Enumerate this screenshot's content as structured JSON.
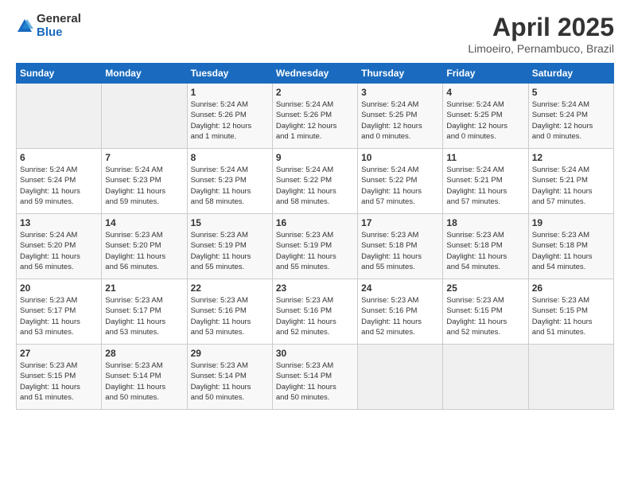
{
  "logo": {
    "general": "General",
    "blue": "Blue"
  },
  "title": {
    "month_year": "April 2025",
    "location": "Limoeiro, Pernambuco, Brazil"
  },
  "header": {
    "days": [
      "Sunday",
      "Monday",
      "Tuesday",
      "Wednesday",
      "Thursday",
      "Friday",
      "Saturday"
    ]
  },
  "weeks": [
    [
      {
        "day": "",
        "info": ""
      },
      {
        "day": "",
        "info": ""
      },
      {
        "day": "1",
        "info": "Sunrise: 5:24 AM\nSunset: 5:26 PM\nDaylight: 12 hours\nand 1 minute."
      },
      {
        "day": "2",
        "info": "Sunrise: 5:24 AM\nSunset: 5:26 PM\nDaylight: 12 hours\nand 1 minute."
      },
      {
        "day": "3",
        "info": "Sunrise: 5:24 AM\nSunset: 5:25 PM\nDaylight: 12 hours\nand 0 minutes."
      },
      {
        "day": "4",
        "info": "Sunrise: 5:24 AM\nSunset: 5:25 PM\nDaylight: 12 hours\nand 0 minutes."
      },
      {
        "day": "5",
        "info": "Sunrise: 5:24 AM\nSunset: 5:24 PM\nDaylight: 12 hours\nand 0 minutes."
      }
    ],
    [
      {
        "day": "6",
        "info": "Sunrise: 5:24 AM\nSunset: 5:24 PM\nDaylight: 11 hours\nand 59 minutes."
      },
      {
        "day": "7",
        "info": "Sunrise: 5:24 AM\nSunset: 5:23 PM\nDaylight: 11 hours\nand 59 minutes."
      },
      {
        "day": "8",
        "info": "Sunrise: 5:24 AM\nSunset: 5:23 PM\nDaylight: 11 hours\nand 58 minutes."
      },
      {
        "day": "9",
        "info": "Sunrise: 5:24 AM\nSunset: 5:22 PM\nDaylight: 11 hours\nand 58 minutes."
      },
      {
        "day": "10",
        "info": "Sunrise: 5:24 AM\nSunset: 5:22 PM\nDaylight: 11 hours\nand 57 minutes."
      },
      {
        "day": "11",
        "info": "Sunrise: 5:24 AM\nSunset: 5:21 PM\nDaylight: 11 hours\nand 57 minutes."
      },
      {
        "day": "12",
        "info": "Sunrise: 5:24 AM\nSunset: 5:21 PM\nDaylight: 11 hours\nand 57 minutes."
      }
    ],
    [
      {
        "day": "13",
        "info": "Sunrise: 5:24 AM\nSunset: 5:20 PM\nDaylight: 11 hours\nand 56 minutes."
      },
      {
        "day": "14",
        "info": "Sunrise: 5:23 AM\nSunset: 5:20 PM\nDaylight: 11 hours\nand 56 minutes."
      },
      {
        "day": "15",
        "info": "Sunrise: 5:23 AM\nSunset: 5:19 PM\nDaylight: 11 hours\nand 55 minutes."
      },
      {
        "day": "16",
        "info": "Sunrise: 5:23 AM\nSunset: 5:19 PM\nDaylight: 11 hours\nand 55 minutes."
      },
      {
        "day": "17",
        "info": "Sunrise: 5:23 AM\nSunset: 5:18 PM\nDaylight: 11 hours\nand 55 minutes."
      },
      {
        "day": "18",
        "info": "Sunrise: 5:23 AM\nSunset: 5:18 PM\nDaylight: 11 hours\nand 54 minutes."
      },
      {
        "day": "19",
        "info": "Sunrise: 5:23 AM\nSunset: 5:18 PM\nDaylight: 11 hours\nand 54 minutes."
      }
    ],
    [
      {
        "day": "20",
        "info": "Sunrise: 5:23 AM\nSunset: 5:17 PM\nDaylight: 11 hours\nand 53 minutes."
      },
      {
        "day": "21",
        "info": "Sunrise: 5:23 AM\nSunset: 5:17 PM\nDaylight: 11 hours\nand 53 minutes."
      },
      {
        "day": "22",
        "info": "Sunrise: 5:23 AM\nSunset: 5:16 PM\nDaylight: 11 hours\nand 53 minutes."
      },
      {
        "day": "23",
        "info": "Sunrise: 5:23 AM\nSunset: 5:16 PM\nDaylight: 11 hours\nand 52 minutes."
      },
      {
        "day": "24",
        "info": "Sunrise: 5:23 AM\nSunset: 5:16 PM\nDaylight: 11 hours\nand 52 minutes."
      },
      {
        "day": "25",
        "info": "Sunrise: 5:23 AM\nSunset: 5:15 PM\nDaylight: 11 hours\nand 52 minutes."
      },
      {
        "day": "26",
        "info": "Sunrise: 5:23 AM\nSunset: 5:15 PM\nDaylight: 11 hours\nand 51 minutes."
      }
    ],
    [
      {
        "day": "27",
        "info": "Sunrise: 5:23 AM\nSunset: 5:15 PM\nDaylight: 11 hours\nand 51 minutes."
      },
      {
        "day": "28",
        "info": "Sunrise: 5:23 AM\nSunset: 5:14 PM\nDaylight: 11 hours\nand 50 minutes."
      },
      {
        "day": "29",
        "info": "Sunrise: 5:23 AM\nSunset: 5:14 PM\nDaylight: 11 hours\nand 50 minutes."
      },
      {
        "day": "30",
        "info": "Sunrise: 5:23 AM\nSunset: 5:14 PM\nDaylight: 11 hours\nand 50 minutes."
      },
      {
        "day": "",
        "info": ""
      },
      {
        "day": "",
        "info": ""
      },
      {
        "day": "",
        "info": ""
      }
    ]
  ]
}
